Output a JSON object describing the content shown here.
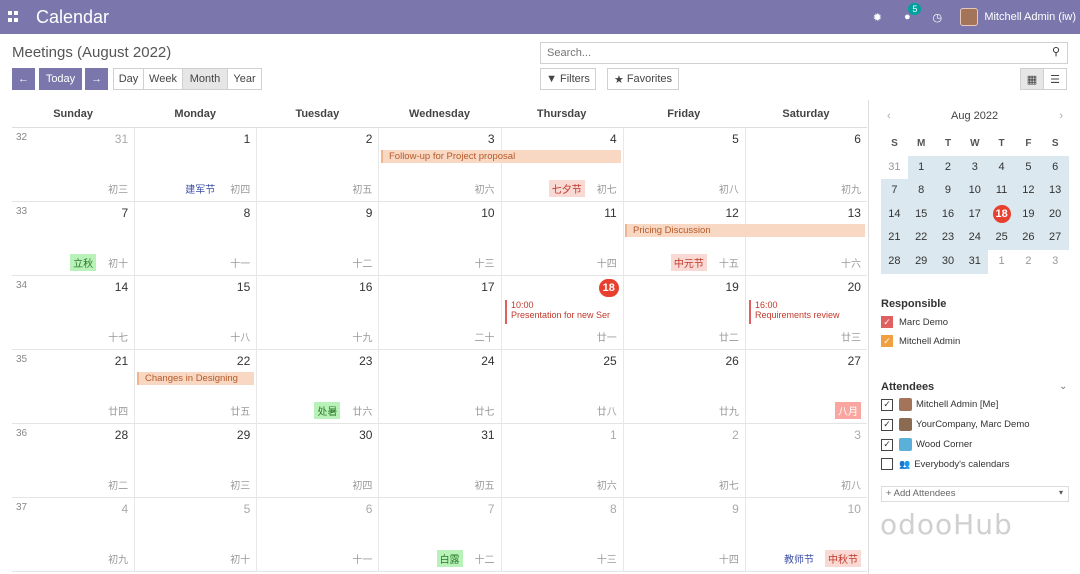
{
  "topbar": {
    "app_title": "Calendar",
    "chat_count": "5",
    "user_name": "Mitchell Admin (iw)",
    "apps_icon": "grid-icon",
    "bug_icon": "bug-icon",
    "chat_icon": "chat-icon",
    "clock_icon": "clock-icon"
  },
  "control": {
    "title": "Meetings (August 2022)",
    "prev_icon": "arrow-left-icon",
    "next_icon": "arrow-right-icon",
    "today": "Today",
    "views": [
      "Day",
      "Week",
      "Month",
      "Year"
    ],
    "active_view": "Month",
    "search_placeholder": "Search...",
    "filters": "Filters",
    "favorites": "Favorites"
  },
  "calendar": {
    "weekdays": [
      "Sunday",
      "Monday",
      "Tuesday",
      "Wednesday",
      "Thursday",
      "Friday",
      "Saturday"
    ],
    "weeks": [
      {
        "num": "32",
        "days": [
          {
            "d": "31",
            "other": true,
            "lunar": "初三"
          },
          {
            "d": "1",
            "lunar": "初四",
            "holiday": "建军节",
            "htype": "blue"
          },
          {
            "d": "2",
            "lunar": "初五"
          },
          {
            "d": "3",
            "lunar": "初六"
          },
          {
            "d": "4",
            "lunar": "初七",
            "holiday": "七夕节",
            "htype": "red"
          },
          {
            "d": "5",
            "lunar": "初八"
          },
          {
            "d": "6",
            "lunar": "初九"
          }
        ]
      },
      {
        "num": "33",
        "days": [
          {
            "d": "7",
            "lunar": "初十",
            "holiday": "立秋",
            "htype": "green"
          },
          {
            "d": "8",
            "lunar": "十一"
          },
          {
            "d": "9",
            "lunar": "十二"
          },
          {
            "d": "10",
            "lunar": "十三"
          },
          {
            "d": "11",
            "lunar": "十四"
          },
          {
            "d": "12",
            "lunar": "十五",
            "holiday": "中元节",
            "htype": "red"
          },
          {
            "d": "13",
            "lunar": "十六"
          }
        ]
      },
      {
        "num": "34",
        "days": [
          {
            "d": "14",
            "lunar": "十七"
          },
          {
            "d": "15",
            "lunar": "十八"
          },
          {
            "d": "16",
            "lunar": "十九"
          },
          {
            "d": "17",
            "lunar": "二十"
          },
          {
            "d": "18",
            "lunar": "廿一",
            "today": true
          },
          {
            "d": "19",
            "lunar": "廿二"
          },
          {
            "d": "20",
            "lunar": "廿三"
          }
        ]
      },
      {
        "num": "35",
        "days": [
          {
            "d": "21",
            "lunar": "廿四"
          },
          {
            "d": "22",
            "lunar": "廿五"
          },
          {
            "d": "23",
            "lunar": "廿六",
            "holiday": "处暑",
            "htype": "green"
          },
          {
            "d": "24",
            "lunar": "廿七"
          },
          {
            "d": "25",
            "lunar": "廿八"
          },
          {
            "d": "26",
            "lunar": "廿九"
          },
          {
            "d": "27",
            "lunar": "",
            "holiday": "八月",
            "htype": "pink"
          }
        ]
      },
      {
        "num": "36",
        "days": [
          {
            "d": "28",
            "lunar": "初二"
          },
          {
            "d": "29",
            "lunar": "初三"
          },
          {
            "d": "30",
            "lunar": "初四"
          },
          {
            "d": "31",
            "lunar": "初五"
          },
          {
            "d": "1",
            "other": true,
            "lunar": "初六"
          },
          {
            "d": "2",
            "other": true,
            "lunar": "初七"
          },
          {
            "d": "3",
            "other": true,
            "lunar": "初八"
          }
        ]
      },
      {
        "num": "37",
        "days": [
          {
            "d": "4",
            "other": true,
            "lunar": "初九"
          },
          {
            "d": "5",
            "other": true,
            "lunar": "初十"
          },
          {
            "d": "6",
            "other": true,
            "lunar": "十一"
          },
          {
            "d": "7",
            "other": true,
            "lunar": "十二",
            "holiday": "白露",
            "htype": "green"
          },
          {
            "d": "8",
            "other": true,
            "lunar": "十三"
          },
          {
            "d": "9",
            "other": true,
            "lunar": "十四"
          },
          {
            "d": "10",
            "other": true,
            "lunar": "",
            "holiday": "中秋节",
            "htype": "red",
            "holiday2": "教师节"
          }
        ]
      }
    ],
    "events": {
      "followup": "Follow-up for Project proposal",
      "pricing": "Pricing Discussion",
      "presentation_time": "10:00",
      "presentation": "Presentation for new Ser",
      "requirements_time": "16:00",
      "requirements": "Requirements review",
      "changes": "Changes in Designing"
    }
  },
  "sidebar": {
    "month": "Aug 2022",
    "prev_icon": "chevron-left-icon",
    "next_icon": "chevron-right-icon",
    "dow": [
      "S",
      "M",
      "T",
      "W",
      "T",
      "F",
      "S"
    ],
    "mini_weeks": [
      [
        "31",
        "1",
        "2",
        "3",
        "4",
        "5",
        "6"
      ],
      [
        "7",
        "8",
        "9",
        "10",
        "11",
        "12",
        "13"
      ],
      [
        "14",
        "15",
        "16",
        "17",
        "18",
        "19",
        "20"
      ],
      [
        "21",
        "22",
        "23",
        "24",
        "25",
        "26",
        "27"
      ],
      [
        "28",
        "29",
        "30",
        "31",
        "1",
        "2",
        "3"
      ]
    ],
    "responsible_title": "Responsible",
    "responsible": [
      {
        "name": "Marc Demo",
        "color": "#e06060"
      },
      {
        "name": "Mitchell Admin",
        "color": "#f0a040"
      }
    ],
    "attendees_title": "Attendees",
    "attendees": [
      {
        "name": "Mitchell Admin [Me]",
        "checked": true
      },
      {
        "name": "YourCompany, Marc Demo",
        "checked": true
      },
      {
        "name": "Wood Corner",
        "checked": true
      },
      {
        "name": "Everybody's calendars",
        "checked": false
      }
    ],
    "add_attendees": "+ Add Attendees"
  },
  "watermark": "odooHub"
}
